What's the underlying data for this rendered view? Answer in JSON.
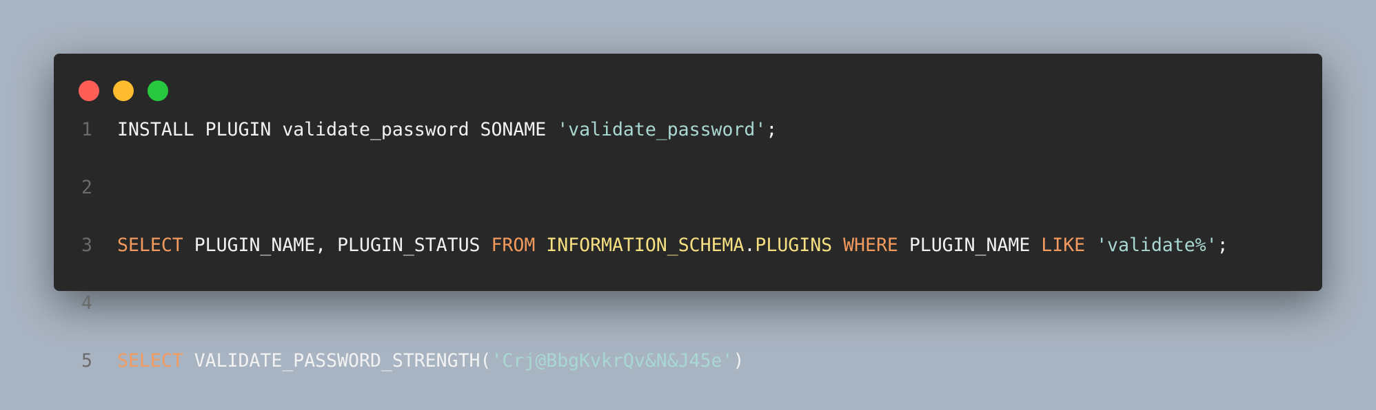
{
  "window": {
    "controls": {
      "close_color": "#ff5f57",
      "minimize_color": "#febc2e",
      "maximize_color": "#28c840"
    }
  },
  "code": {
    "lines": [
      {
        "number": "1",
        "tokens": [
          {
            "text": "INSTALL PLUGIN validate_password SONAME ",
            "kind": "plain"
          },
          {
            "text": "'validate_password'",
            "kind": "str"
          },
          {
            "text": ";",
            "kind": "plain"
          }
        ]
      },
      {
        "number": "2",
        "tokens": []
      },
      {
        "number": "3",
        "tokens": [
          {
            "text": "SELECT",
            "kind": "kw"
          },
          {
            "text": " PLUGIN_NAME, PLUGIN_STATUS ",
            "kind": "plain"
          },
          {
            "text": "FROM",
            "kind": "kw"
          },
          {
            "text": " ",
            "kind": "plain"
          },
          {
            "text": "INFORMATION_SCHEMA",
            "kind": "ident"
          },
          {
            "text": ".",
            "kind": "plain"
          },
          {
            "text": "PLUGINS",
            "kind": "ident"
          },
          {
            "text": " ",
            "kind": "plain"
          },
          {
            "text": "WHERE",
            "kind": "kw"
          },
          {
            "text": " PLUGIN_NAME ",
            "kind": "plain"
          },
          {
            "text": "LIKE",
            "kind": "kw"
          },
          {
            "text": " ",
            "kind": "plain"
          },
          {
            "text": "'validate%'",
            "kind": "str"
          },
          {
            "text": ";",
            "kind": "plain"
          }
        ]
      },
      {
        "number": "4",
        "tokens": []
      },
      {
        "number": "5",
        "tokens": [
          {
            "text": "SELECT",
            "kind": "kw"
          },
          {
            "text": " VALIDATE_PASSWORD_STRENGTH(",
            "kind": "plain"
          },
          {
            "text": "'Crj@BbgKvkrQv&N&J45e'",
            "kind": "str"
          },
          {
            "text": ")",
            "kind": "plain"
          }
        ]
      }
    ]
  }
}
